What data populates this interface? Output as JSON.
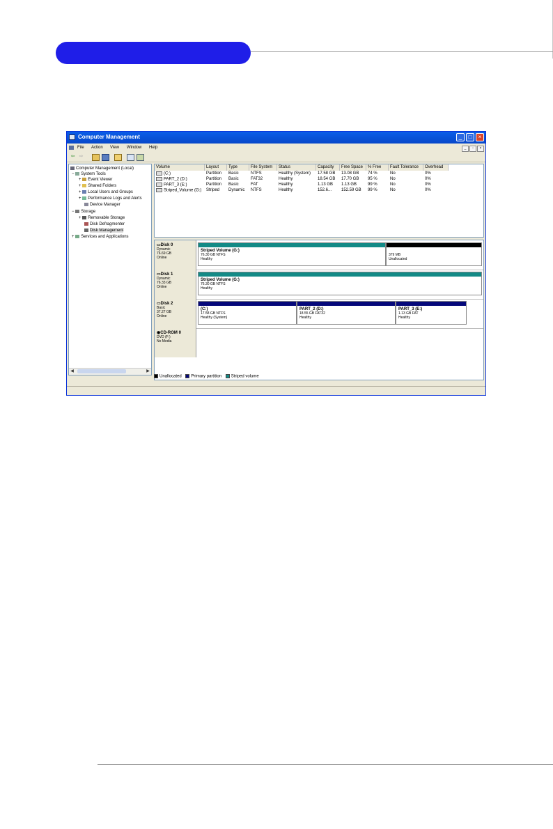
{
  "colors": {
    "header_pill": "#1f1ee8",
    "titlebar": "#0a5ee8",
    "striped": "#138a86",
    "primary": "#05087a",
    "unallocated": "#000000"
  },
  "window": {
    "title": "Computer Management",
    "controls": {
      "minimize": "_",
      "maximize": "□",
      "close": "×"
    }
  },
  "menu": {
    "items": [
      "File",
      "Action",
      "View",
      "Window",
      "Help"
    ]
  },
  "mdi_controls": {
    "minimize": "_",
    "restore": "▫",
    "close": "×"
  },
  "toolbar": {
    "icons": [
      "back-arrow-icon",
      "forward-arrow-icon",
      "folder-up-icon",
      "console-icon",
      "properties-icon",
      "export-icon",
      "help-icon"
    ],
    "back": "⇦",
    "forward": "⇨"
  },
  "tree": {
    "root": "Computer Management (Local)",
    "system_tools": "System Tools",
    "event_viewer": "Event Viewer",
    "shared_folders": "Shared Folders",
    "local_users": "Local Users and Groups",
    "perf_logs": "Performance Logs and Alerts",
    "device_manager": "Device Manager",
    "storage": "Storage",
    "removable_storage": "Removable Storage",
    "disk_defrag": "Disk Defragmenter",
    "disk_management": "Disk Management",
    "services_apps": "Services and Applications",
    "expander_plus": "+",
    "expander_minus": "−",
    "scroll_left": "◀",
    "scroll_right": "▶"
  },
  "volumes": {
    "headers": [
      "Volume",
      "Layout",
      "Type",
      "File System",
      "Status",
      "Capacity",
      "Free Space",
      "% Free",
      "Fault Tolerance",
      "Overhead"
    ],
    "rows": [
      [
        "(C:)",
        "Partition",
        "Basic",
        "NTFS",
        "Healthy (System)",
        "17.58 GB",
        "13.08 GB",
        "74 %",
        "No",
        "0%"
      ],
      [
        "PART_2 (D:)",
        "Partition",
        "Basic",
        "FAT32",
        "Healthy",
        "18.54 GB",
        "17.70 GB",
        "95 %",
        "No",
        "0%"
      ],
      [
        "PART_3 (E:)",
        "Partition",
        "Basic",
        "FAT",
        "Healthy",
        "1.13 GB",
        "1.13 GB",
        "99 %",
        "No",
        "0%"
      ],
      [
        "Striped_Volume (G:)",
        "Striped",
        "Dynamic",
        "NTFS",
        "Healthy",
        "152.6...",
        "152.59 GB",
        "99 %",
        "No",
        "0%"
      ]
    ]
  },
  "disks": [
    {
      "name": "Disk 0",
      "type": "Dynamic",
      "size": "76.69 GB",
      "state": "Online",
      "partitions": [
        {
          "label": "Striped Volume (G:)",
          "detail": "76.30 GB NTFS",
          "status": "Healthy",
          "kind": "striped"
        },
        {
          "label": "",
          "detail": "379 MB",
          "status": "Unallocated",
          "kind": "unallocated"
        }
      ]
    },
    {
      "name": "Disk 1",
      "type": "Dynamic",
      "size": "76.33 GB",
      "state": "Online",
      "partitions": [
        {
          "label": "Striped Volume (G:)",
          "detail": "76.30 GB NTFS",
          "status": "Healthy",
          "kind": "striped"
        }
      ]
    },
    {
      "name": "Disk 2",
      "type": "Basic",
      "size": "37.27 GB",
      "state": "Online",
      "partitions": [
        {
          "label": "(C:)",
          "detail": "17.58 GB NTFS",
          "status": "Healthy (System)",
          "kind": "primary"
        },
        {
          "label": "PART_2 (D:)",
          "detail": "18.55 GB FAT32",
          "status": "Healthy",
          "kind": "primary"
        },
        {
          "label": "PART_3 (E:)",
          "detail": "1.13 GB FAT",
          "status": "Healthy",
          "kind": "primary"
        }
      ]
    },
    {
      "name": "CD-ROM 0",
      "type": "DVD (F:)",
      "size": "",
      "state": "No Media",
      "partitions": []
    }
  ],
  "legend": {
    "unallocated": "Unallocated",
    "primary": "Primary partition",
    "striped": "Striped volume"
  }
}
